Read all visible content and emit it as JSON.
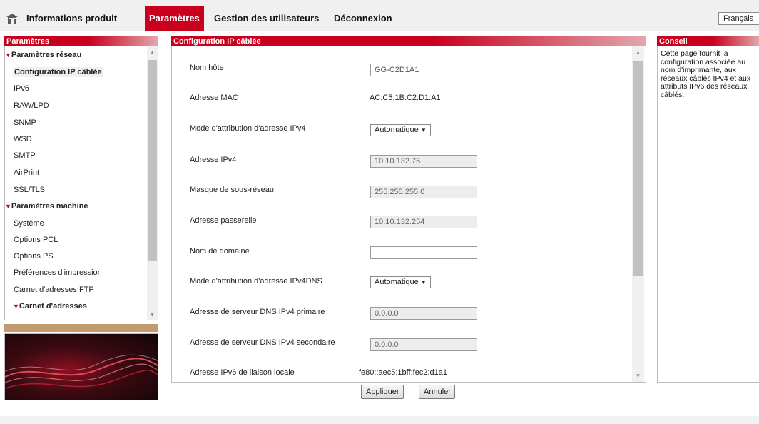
{
  "topnav": {
    "items": [
      {
        "label": "Informations produit",
        "active": false
      },
      {
        "label": "Paramètres",
        "active": true
      },
      {
        "label": "Gestion des utilisateurs",
        "active": false
      },
      {
        "label": "Déconnexion",
        "active": false
      }
    ],
    "home_icon": "home-icon",
    "language": "Français"
  },
  "sidebar": {
    "header": "Paramètres",
    "sections": [
      {
        "label": "Paramètres réseau"
      },
      {
        "label": "Paramètres machine"
      },
      {
        "label": "Carnet d'adresses"
      }
    ],
    "items": [
      {
        "label": "Configuration IP câblée",
        "selected": true
      },
      {
        "label": "IPv6"
      },
      {
        "label": "RAW/LPD"
      },
      {
        "label": "SNMP"
      },
      {
        "label": "WSD"
      },
      {
        "label": "SMTP"
      },
      {
        "label": "AirPrint"
      },
      {
        "label": "SSL/TLS"
      },
      {
        "label": "Système"
      },
      {
        "label": "Options PCL"
      },
      {
        "label": "Options PS"
      },
      {
        "label": "Préférences d'impression"
      },
      {
        "label": "Carnet d'adresses FTP"
      }
    ]
  },
  "main": {
    "header": "Configuration IP câblée",
    "fields": [
      {
        "label": "Nom hôte",
        "value": "GG-C2D1A1",
        "kind": "input"
      },
      {
        "label": "Adresse MAC",
        "value": "AC:C5:1B:C2:D1:A1",
        "kind": "text"
      },
      {
        "label": "Mode d'attribution d'adresse IPv4",
        "value": "Automatique",
        "kind": "select"
      },
      {
        "label": "Adresse IPv4",
        "value": "10.10.132.75",
        "kind": "readonly"
      },
      {
        "label": "Masque de sous-réseau",
        "value": "255.255.255.0",
        "kind": "readonly"
      },
      {
        "label": "Adresse passerelle",
        "value": "10.10.132.254",
        "kind": "readonly"
      },
      {
        "label": "Nom de domaine",
        "value": "",
        "kind": "input"
      },
      {
        "label": "Mode d'attribution d'adresse IPv4DNS",
        "value": "Automatique",
        "kind": "select"
      },
      {
        "label": "Adresse de serveur DNS IPv4 primaire",
        "value": "0.0.0.0",
        "kind": "readonly"
      },
      {
        "label": "Adresse de serveur DNS IPv4 secondaire",
        "value": "0.0.0.0",
        "kind": "readonly"
      },
      {
        "label": "Adresse IPv6 de liaison locale",
        "value": "fe80::aec5:1bff:fec2:d1a1",
        "kind": "text"
      }
    ],
    "buttons": {
      "apply": "Appliquer",
      "cancel": "Annuler"
    }
  },
  "tip": {
    "header": "Conseil",
    "text": "Cette page fournit la configuration associée au nom d'imprimante, aux réseaux câblés IPv4 et aux attributs IPv6 des réseaux câblés."
  },
  "colors": {
    "accent": "#c8001e",
    "sidebar_bar": "#c49a70"
  }
}
